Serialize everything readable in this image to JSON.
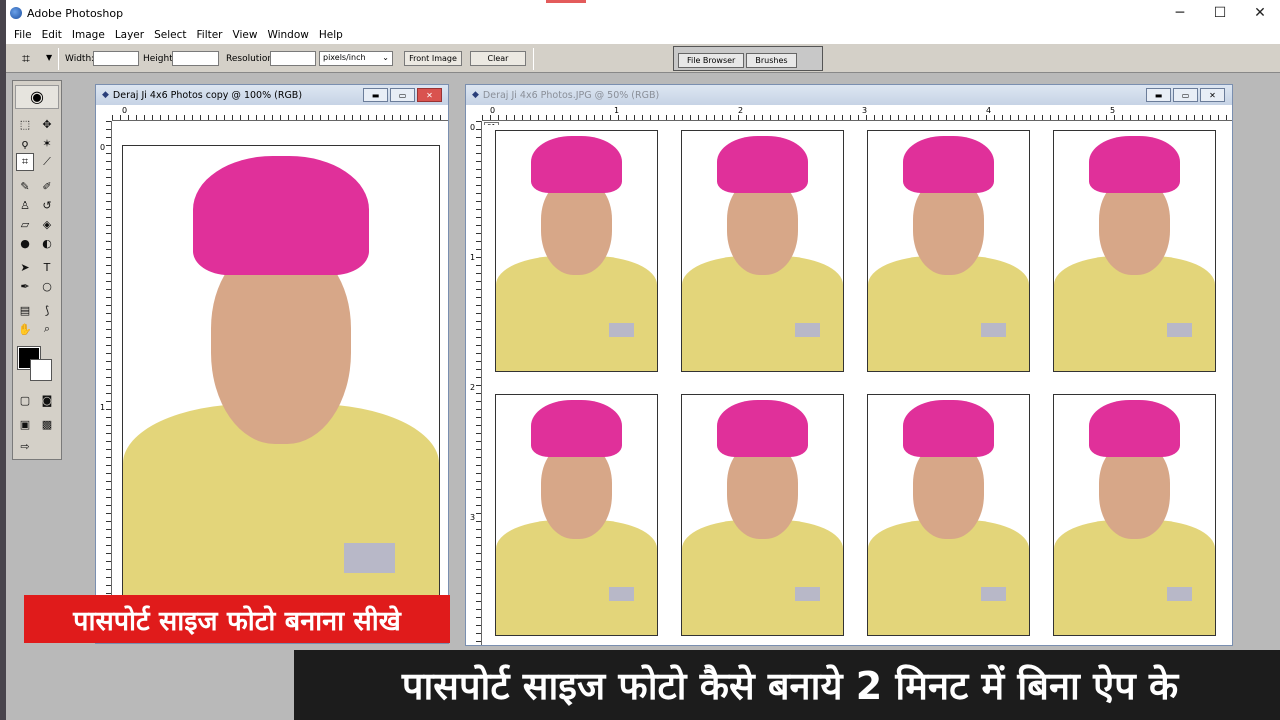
{
  "app": {
    "title": "Adobe Photoshop",
    "window_controls": {
      "minimize": "─",
      "maximize": "☐",
      "close": "✕"
    }
  },
  "menu": [
    "File",
    "Edit",
    "Image",
    "Layer",
    "Select",
    "Filter",
    "View",
    "Window",
    "Help"
  ],
  "options_bar": {
    "width_label": "Width:",
    "width_value": "",
    "height_label": "Height:",
    "height_value": "",
    "resolution_label": "Resolution:",
    "resolution_value": "",
    "unit_selected": "pixels/inch",
    "front_image_label": "Front Image",
    "clear_label": "Clear",
    "palette_tabs": [
      "File Browser",
      "Brushes"
    ]
  },
  "documents": [
    {
      "title": "Deraj Ji 4x6 Photos copy @ 100% (RGB)",
      "active": true,
      "h_ruler": [
        "0"
      ],
      "v_ruler": [
        "0",
        "1"
      ],
      "layer_tag": "01"
    },
    {
      "title": "Deraj Ji 4x6 Photos.JPG @ 50% (RGB)",
      "active": false,
      "h_ruler": [
        "0",
        "1",
        "2",
        "3",
        "4",
        "5"
      ],
      "v_ruler": [
        "0",
        "1",
        "2",
        "3"
      ],
      "layer_tag": "01",
      "photo_grid": {
        "rows": 2,
        "cols": 4
      }
    }
  ],
  "captions": {
    "small": "पासपोर्ट साइज फोटो बनाना सीखे",
    "large": "पासपोर्ट साइज फोटो कैसे बनाये 2 मिनट में बिना ऐप के"
  },
  "colors": {
    "caption_small_bg": "#e01b1b",
    "caption_large_bg": "#1c1c1c",
    "turban": "#e0309a",
    "shirt": "#e3d57a"
  }
}
